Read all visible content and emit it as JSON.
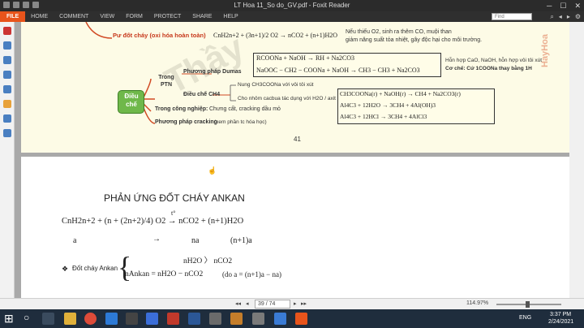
{
  "window": {
    "title": "LT Hoa 11_So do_GV.pdf - Foxit Reader"
  },
  "menu": {
    "file": "FILE",
    "items": [
      "HOME",
      "COMMENT",
      "VIEW",
      "FORM",
      "PROTECT",
      "SHARE",
      "HELP"
    ],
    "search_placeholder": "Find"
  },
  "page1": {
    "combustion_label": "Pư đốt cháy (oxi hóa hoàn toàn)",
    "combustion_eq": "CnH2n+2 + (3n+1)/2 O2 → nCO2 + (n+1)H2O",
    "combustion_note1": "Nếu thiếu O2, sinh ra thêm CO, muội than",
    "combustion_note2": "giảm năng suất tỏa nhiệt, gây độc hại cho môi trường.",
    "dumas_label": "Phương pháp Dumas",
    "eq_r1": "RCOONa + NaOH → RH + Na2CO3",
    "eq_r2": "NaOOC − CH2 − COONa + NaOH → CH3 − CH3 + Na2CO3",
    "mix_note": "Hỗn hợp CaO, NaOH, hỗn hợp vôi tôi xút",
    "note_rule": "Cơ chế: Cứ 1COONa thay bằng 1H",
    "center_node": "Điều chế",
    "lab_label": "Trong PTN",
    "ch4_label": "Điều chế CH4",
    "ch4_opt1": "Nung CH3COONa với vôi tôi xút",
    "ch4_opt2": "Cho nhôm cacbua tác dụng với H2O / axit",
    "eq_b1": "CH3COONa(r) + NaOH(r) → CH4 + Na2CO3(r)",
    "eq_b2": "Al4C3 + 12H2O → 3CH4 + 4Al(OH)3",
    "eq_b3": "Al4C3 + 12HCl → 3CH4 + 4AlCl3",
    "industry_label": "Trong công nghiệp:",
    "industry_text": "Chưng cất, cracking dầu mỏ",
    "cracking_label": "Phương pháp cracking",
    "cracking_text": "(xem phần tc hóa học)",
    "page_number": "41",
    "watermark": "Thầy",
    "side_text": "HayHoa"
  },
  "page2": {
    "heading": "PHẢN ỨNG ĐỐT CHÁY ANKAN",
    "eq_main": "CnH2n+2 + (n + (2n+2)/4) O2 → nCO2 + (n+1)H2O",
    "cond": "t°",
    "row2_a": "a",
    "row2_arrow": "→",
    "row2_na": "na",
    "row2_n1a": "(n+1)a",
    "bullet_label": "Đốt cháy Ankan",
    "case1": "nH2O 〉 nCO2",
    "case2": "nAnkan = nH2O − nCO2",
    "case2_note": "(do a = (n+1)a − na)"
  },
  "status": {
    "page_indicator": "39 / 74",
    "zoom": "114.97%"
  },
  "taskbar": {
    "time": "3:37 PM",
    "date": "2/24/2021",
    "lang": "ENG"
  }
}
